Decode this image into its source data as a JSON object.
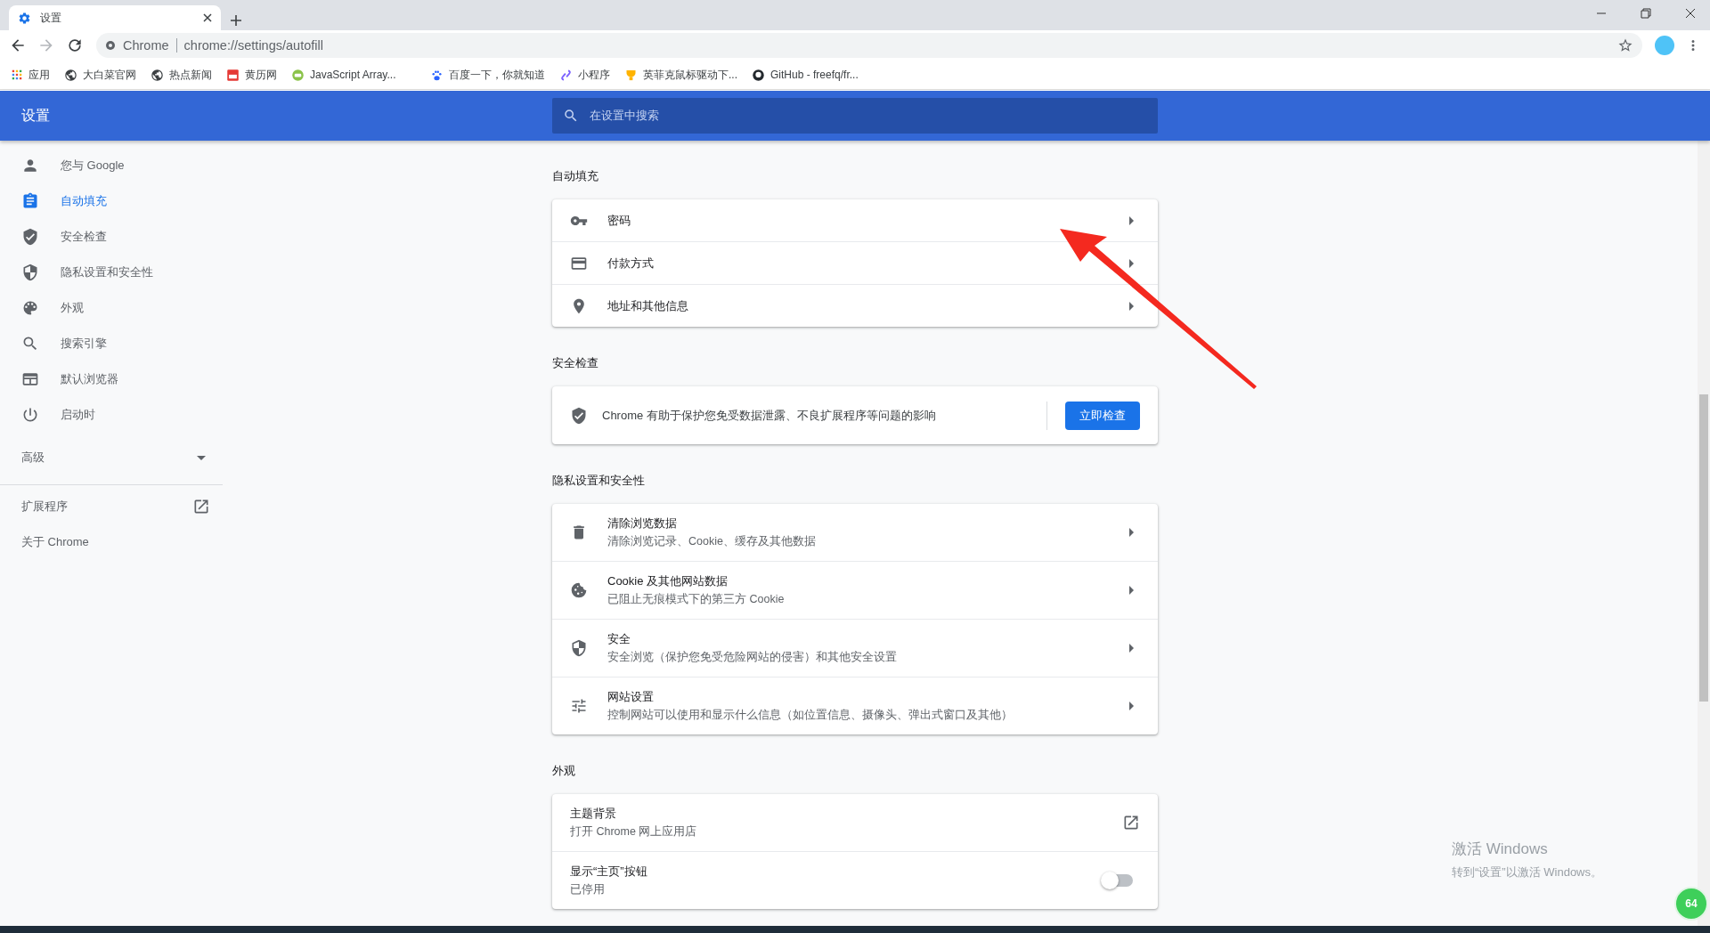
{
  "browser": {
    "tab": {
      "title": "设置"
    },
    "omnibox": {
      "site_label": "Chrome",
      "url": "chrome://settings/autofill"
    },
    "bookmarks": [
      {
        "label": "应用"
      },
      {
        "label": "大白菜官网"
      },
      {
        "label": "热点新闻"
      },
      {
        "label": "黄历网"
      },
      {
        "label": "JavaScript Array..."
      },
      {
        "label": "百度一下，你就知道"
      },
      {
        "label": "小程序"
      },
      {
        "label": "英菲克鼠标驱动下..."
      },
      {
        "label": "GitHub - freefq/fr..."
      }
    ]
  },
  "settings": {
    "title": "设置",
    "search": {
      "placeholder": "在设置中搜索"
    }
  },
  "sidebar": {
    "items": [
      {
        "label": "您与 Google",
        "selected": false
      },
      {
        "label": "自动填充",
        "selected": true
      },
      {
        "label": "安全检查",
        "selected": false
      },
      {
        "label": "隐私设置和安全性",
        "selected": false
      },
      {
        "label": "外观",
        "selected": false
      },
      {
        "label": "搜索引擎",
        "selected": false
      },
      {
        "label": "默认浏览器",
        "selected": false
      },
      {
        "label": "启动时",
        "selected": false
      }
    ],
    "advanced": {
      "label": "高级",
      "expanded": false
    },
    "extensions": {
      "label": "扩展程序"
    },
    "about": {
      "label": "关于 Chrome"
    }
  },
  "sections": [
    {
      "title": "自动填充",
      "kind": "list",
      "rows": [
        {
          "kind": "arrow",
          "label": "密码"
        },
        {
          "kind": "arrow",
          "label": "付款方式"
        },
        {
          "kind": "arrow",
          "label": "地址和其他信息"
        }
      ]
    },
    {
      "title": "安全检查",
      "kind": "safety",
      "text": "Chrome 有助于保护您免受数据泄露、不良扩展程序等问题的影响",
      "button": "立即检查"
    },
    {
      "title": "隐私设置和安全性",
      "kind": "list",
      "rows": [
        {
          "kind": "arrow",
          "label": "清除浏览数据",
          "sublabel": "清除浏览记录、Cookie、缓存及其他数据"
        },
        {
          "kind": "arrow",
          "label": "Cookie 及其他网站数据",
          "sublabel": "已阻止无痕模式下的第三方 Cookie"
        },
        {
          "kind": "arrow",
          "label": "安全",
          "sublabel": "安全浏览（保护您免受危险网站的侵害）和其他安全设置"
        },
        {
          "kind": "arrow",
          "label": "网站设置",
          "sublabel": "控制网站可以使用和显示什么信息（如位置信息、摄像头、弹出式窗口及其他）"
        }
      ]
    },
    {
      "title": "外观",
      "kind": "list",
      "rows": [
        {
          "kind": "link",
          "label": "主题背景",
          "sublabel": "打开 Chrome 网上应用店"
        },
        {
          "kind": "toggle",
          "label": "显示“主页”按钮",
          "sublabel": "已停用",
          "on": false
        }
      ]
    }
  ],
  "windows_activation": {
    "title": "激活 Windows",
    "message": "转到“设置”以激活 Windows。"
  },
  "floating_badge": {
    "text": "64"
  }
}
